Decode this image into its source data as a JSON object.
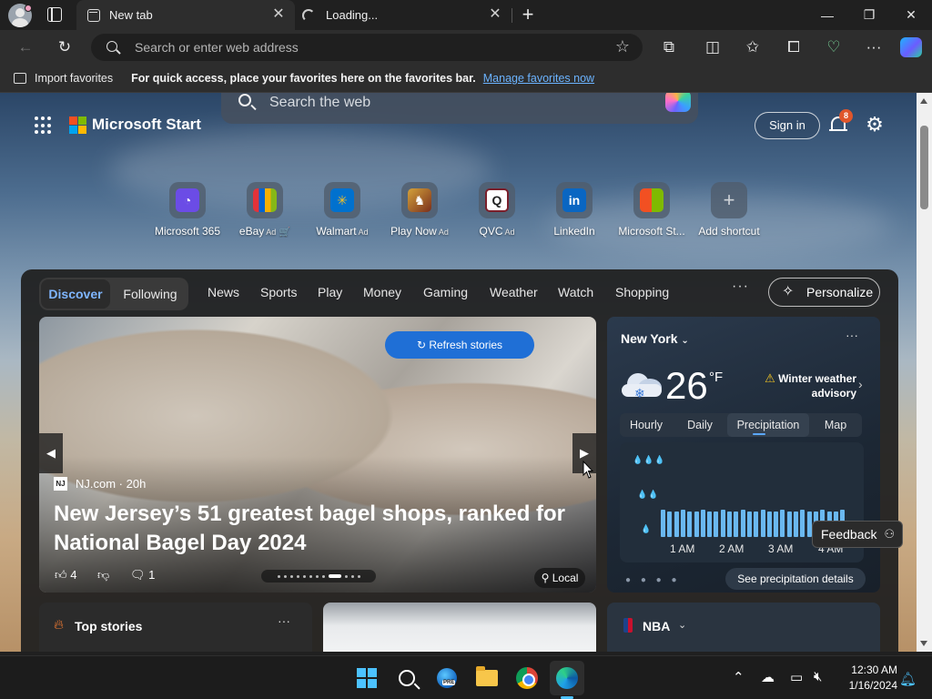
{
  "browser": {
    "tabs": [
      {
        "label": "New tab",
        "close": "✕"
      },
      {
        "label": "Loading...",
        "close": "✕"
      }
    ],
    "new_tab": "+",
    "window_controls": {
      "minimize": "—",
      "restore": "❐",
      "close": "✕"
    },
    "address_placeholder": "Search or enter web address",
    "favorites_bar": {
      "import_label": "Import favorites",
      "hint": "For quick access, place your favorites here on the favorites bar.",
      "manage_link": "Manage favorites now"
    }
  },
  "page": {
    "brand": "Microsoft Start",
    "search_placeholder": "Search the web",
    "sign_in": "Sign in",
    "notification_count": "8",
    "shortcuts": [
      {
        "label": "Microsoft 365",
        "ad": "",
        "icon": "microsoft-365-icon",
        "glyph": "◔",
        "color": "#6b4ce6"
      },
      {
        "label": "eBay",
        "ad": "Ad",
        "icon": "ebay-icon",
        "glyph": "▦",
        "color": "#2a2a2a"
      },
      {
        "label": "Walmart",
        "ad": "Ad",
        "icon": "walmart-icon",
        "glyph": "✳",
        "color": "#0071ce"
      },
      {
        "label": "Play Now",
        "ad": "Ad",
        "icon": "play-now-icon",
        "glyph": "♞",
        "color": "#8a3b22"
      },
      {
        "label": "QVC",
        "ad": "Ad",
        "icon": "qvc-icon",
        "glyph": "Q",
        "color": "#ffffff"
      },
      {
        "label": "LinkedIn",
        "ad": "",
        "icon": "linkedin-icon",
        "glyph": "in",
        "color": "#0a66c2"
      },
      {
        "label": "Microsoft St...",
        "ad": "",
        "icon": "microsoft-store-icon",
        "glyph": "▣",
        "color": "#3c4350"
      },
      {
        "label": "Add shortcut",
        "ad": "",
        "icon": "plus-icon",
        "glyph": "+",
        "color": "#6a7280"
      }
    ],
    "feed_tabs": {
      "discover": "Discover",
      "following": "Following"
    },
    "nav": [
      "News",
      "Sports",
      "Play",
      "Money",
      "Gaming",
      "Weather",
      "Watch",
      "Shopping"
    ],
    "nav_more": "···",
    "personalize": "Personalize"
  },
  "hero": {
    "refresh": "Refresh stories",
    "source": "NJ.com",
    "source_logo": "NJ",
    "age": "20h",
    "headline": "New Jersey’s 51 greatest bagel shops, ranked for National Bagel Day 2024",
    "likes": "4",
    "comments": "1",
    "local": "Local"
  },
  "weather": {
    "city": "New York",
    "temp": "26",
    "unit": "°F",
    "alert": "Winter weather advisory",
    "tabs": [
      "Hourly",
      "Daily",
      "Precipitation",
      "Map"
    ],
    "active_tab": "Precipitation",
    "chart_ticks": [
      "1 AM",
      "2 AM",
      "3 AM",
      "4 AM"
    ],
    "details": "See precipitation details"
  },
  "cards": {
    "top_stories": "Top stories",
    "nba": "NBA"
  },
  "feedback": "Feedback",
  "taskbar": {
    "time": "12:30 AM",
    "date": "1/16/2024"
  },
  "colors": {
    "accent": "#1f6fd6",
    "link": "#6bb3ff",
    "badge": "#e0562b",
    "windows": "#4cc2ff"
  }
}
